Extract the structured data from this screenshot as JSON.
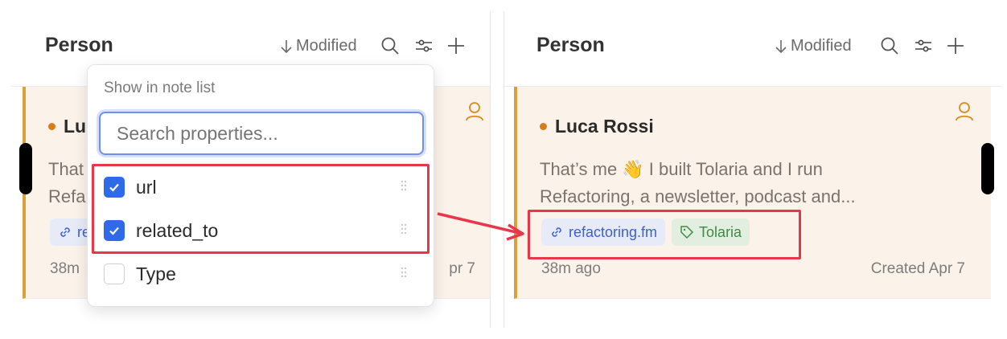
{
  "left_panel": {
    "title": "Person",
    "sort_label": "Modified",
    "card": {
      "title_partial": "Lu",
      "snippet_line1": "That",
      "snippet_line2": "Refa",
      "link_chip_partial": "re",
      "meta_left": "38m",
      "meta_right": "pr 7"
    }
  },
  "dropdown": {
    "title": "Show in note list",
    "search_placeholder": "Search properties...",
    "items": [
      {
        "label": "url",
        "checked": true
      },
      {
        "label": "related_to",
        "checked": true
      },
      {
        "label": "Type",
        "checked": false
      }
    ]
  },
  "right_panel": {
    "title": "Person",
    "sort_label": "Modified",
    "card": {
      "title": "Luca Rossi",
      "snippet_line1": "That’s me 👋 I built Tolaria and I run",
      "snippet_line2": "Refactoring, a newsletter, podcast and...",
      "link_chip": "refactoring.fm",
      "tag_chip": "Tolaria",
      "meta_left": "38m ago",
      "meta_right": "Created Apr 7"
    }
  },
  "colors": {
    "accent_blue": "#2f6be8",
    "highlight_red": "#e8364a",
    "card_bg": "#fbf3ea",
    "card_border": "#d9a03c",
    "status_dot": "#d97b17"
  },
  "icons": [
    "arrow-down-icon",
    "search-icon",
    "sliders-icon",
    "plus-icon",
    "person-icon",
    "link-icon",
    "tag-icon",
    "check-icon",
    "drag-handle-icon"
  ]
}
